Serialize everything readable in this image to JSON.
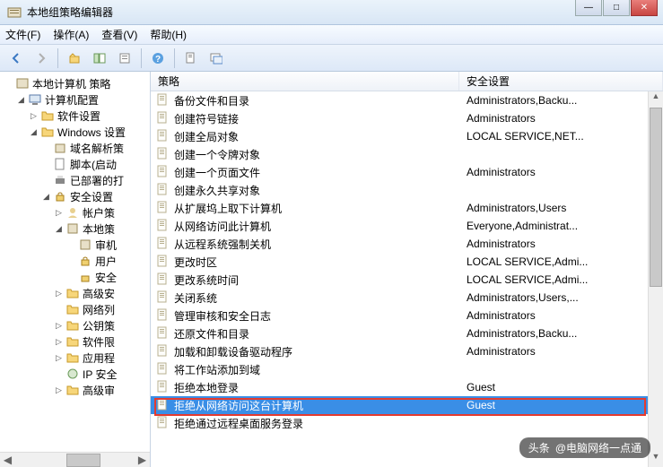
{
  "window": {
    "title": "本地组策略编辑器"
  },
  "menu": {
    "file": "文件(F)",
    "action": "操作(A)",
    "view": "查看(V)",
    "help": "帮助(H)"
  },
  "tree": {
    "root": "本地计算机 策略",
    "computer_cfg": "计算机配置",
    "software": "软件设置",
    "windows": "Windows 设置",
    "dns": "域名解析策",
    "script": "脚本(启动",
    "deployed": "已部署的打",
    "security": "安全设置",
    "account": "帐户策",
    "local": "本地策",
    "audit": "审机",
    "user_rights": "用户",
    "sec_opt": "安全",
    "advanced": "高级安",
    "network_list": "网络列",
    "public_key": "公钥策",
    "software_restrict": "软件限",
    "app_ctrl": "应用程",
    "ip_sec": "IP 安全",
    "adv_audit": "高级审"
  },
  "columns": {
    "policy": "策略",
    "security": "安全设置"
  },
  "rows": [
    {
      "policy": "备份文件和目录",
      "security": "Administrators,Backu..."
    },
    {
      "policy": "创建符号链接",
      "security": "Administrators"
    },
    {
      "policy": "创建全局对象",
      "security": "LOCAL SERVICE,NET..."
    },
    {
      "policy": "创建一个令牌对象",
      "security": ""
    },
    {
      "policy": "创建一个页面文件",
      "security": "Administrators"
    },
    {
      "policy": "创建永久共享对象",
      "security": ""
    },
    {
      "policy": "从扩展坞上取下计算机",
      "security": "Administrators,Users"
    },
    {
      "policy": "从网络访问此计算机",
      "security": "Everyone,Administrat..."
    },
    {
      "policy": "从远程系统强制关机",
      "security": "Administrators"
    },
    {
      "policy": "更改时区",
      "security": "LOCAL SERVICE,Admi..."
    },
    {
      "policy": "更改系统时间",
      "security": "LOCAL SERVICE,Admi..."
    },
    {
      "policy": "关闭系统",
      "security": "Administrators,Users,..."
    },
    {
      "policy": "管理审核和安全日志",
      "security": "Administrators"
    },
    {
      "policy": "还原文件和目录",
      "security": "Administrators,Backu..."
    },
    {
      "policy": "加载和卸载设备驱动程序",
      "security": "Administrators"
    },
    {
      "policy": "将工作站添加到域",
      "security": ""
    },
    {
      "policy": "拒绝本地登录",
      "security": "Guest"
    },
    {
      "policy": "拒绝从网络访问这台计算机",
      "security": "Guest",
      "selected": true
    },
    {
      "policy": "拒绝通过远程桌面服务登录",
      "security": ""
    }
  ],
  "watermark": {
    "prefix": "头条",
    "text": "@电脑网络一点通"
  }
}
